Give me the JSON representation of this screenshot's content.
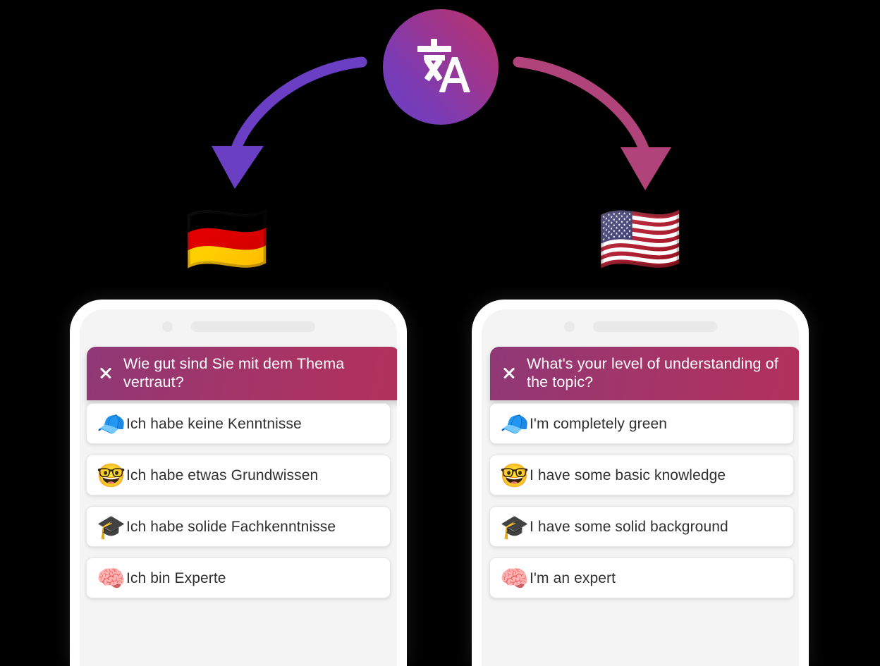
{
  "scene": {
    "translate_badge": {
      "icon": "translate-icon",
      "glyph_source": "文",
      "glyph_target": "A",
      "gradient_start": "#6a3fc6",
      "gradient_end": "#bb3268"
    },
    "arrows": [
      {
        "name": "arrow-to-german",
        "color": "#6b3fc4",
        "direction": "down-left"
      },
      {
        "name": "arrow-to-english",
        "color": "#b0437a",
        "direction": "down-right"
      }
    ]
  },
  "phones": [
    {
      "id": "german",
      "flag": "🇩🇪",
      "flag_name": "german-flag",
      "survey": {
        "close_label": "×",
        "title": "Wie gut sind Sie mit dem Thema vertraut?",
        "header_gradient_start": "#8f3876",
        "header_gradient_end": "#b2315b",
        "options": [
          {
            "emoji": "🧢",
            "emoji_name": "billed-cap-emoji",
            "label": "Ich habe keine Kenntnisse"
          },
          {
            "emoji": "🤓",
            "emoji_name": "nerd-face-emoji",
            "label": "Ich habe etwas Grundwissen"
          },
          {
            "emoji": "🎓",
            "emoji_name": "graduation-cap-emoji",
            "label": "Ich habe solide Fachkenntnisse"
          },
          {
            "emoji": "🧠",
            "emoji_name": "brain-emoji",
            "label": "Ich bin Experte"
          }
        ]
      }
    },
    {
      "id": "english",
      "flag": "🇺🇸",
      "flag_name": "us-flag",
      "survey": {
        "close_label": "×",
        "title": "What's your level of understanding of the topic?",
        "header_gradient_start": "#8f3876",
        "header_gradient_end": "#b2315b",
        "options": [
          {
            "emoji": "🧢",
            "emoji_name": "billed-cap-emoji",
            "label": "I'm completely green"
          },
          {
            "emoji": "🤓",
            "emoji_name": "nerd-face-emoji",
            "label": "I have some basic knowledge"
          },
          {
            "emoji": "🎓",
            "emoji_name": "graduation-cap-emoji",
            "label": "I have some solid background"
          },
          {
            "emoji": "🧠",
            "emoji_name": "brain-emoji",
            "label": "I'm an expert"
          }
        ]
      }
    }
  ]
}
